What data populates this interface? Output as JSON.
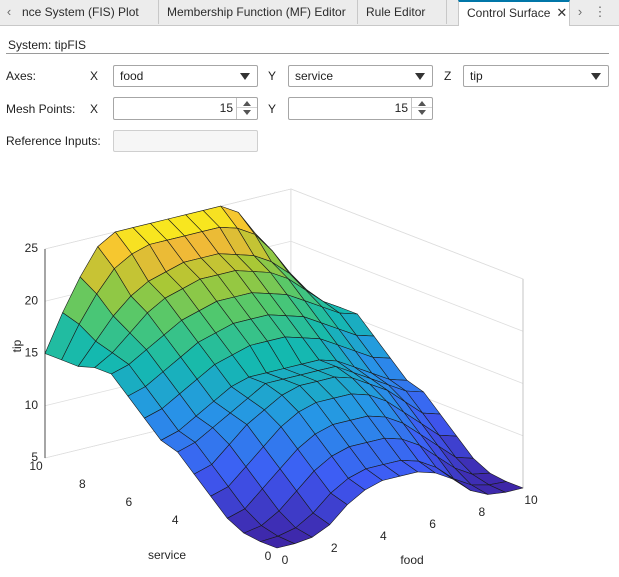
{
  "tabs": [
    {
      "label": "nce System (FIS) Plot",
      "active": false
    },
    {
      "label": "Membership Function (MF) Editor",
      "active": false
    },
    {
      "label": "Rule Editor",
      "active": false
    },
    {
      "label": "Control Surface",
      "active": true
    }
  ],
  "tab_strip": {
    "left_icon": "chevron-left-icon",
    "right_icon": "chevron-right-icon",
    "menu_icon": "vertical-ellipsis-icon",
    "close_icon": "close-icon"
  },
  "system_label": "System: tipFIS",
  "axes": {
    "label": "Axes:",
    "x_letter": "X",
    "x_value": "food",
    "y_letter": "Y",
    "y_value": "service",
    "z_letter": "Z",
    "z_value": "tip"
  },
  "mesh": {
    "label": "Mesh Points:",
    "x_letter": "X",
    "x_value": "15",
    "y_letter": "Y",
    "y_value": "15"
  },
  "reference_inputs": {
    "label": "Reference Inputs:",
    "value": ""
  },
  "chart_data": {
    "type": "surface",
    "x": {
      "label": "food",
      "range": [
        0,
        10
      ],
      "ticks": [
        "0",
        "2",
        "4",
        "6",
        "8",
        "10"
      ]
    },
    "y": {
      "label": "service",
      "range": [
        0,
        10
      ],
      "ticks": [
        "0",
        "4",
        "6",
        "8",
        "10"
      ]
    },
    "z": {
      "label": "tip",
      "range": [
        5,
        25
      ],
      "ticks": [
        "5",
        "10",
        "15",
        "20",
        "25"
      ]
    },
    "mesh_points": [
      15,
      15
    ],
    "colormap": "parula",
    "grid": true,
    "z_values_description_rows_service_cols_food": [
      [
        5.0,
        5.0,
        5.2,
        6.0,
        7.5,
        8.5,
        9.0,
        9.0,
        9.0,
        8.5,
        7.5,
        6.0,
        5.2,
        5.0,
        5.0
      ],
      [
        5.0,
        5.1,
        5.5,
        6.5,
        8.0,
        9.0,
        9.5,
        9.5,
        9.5,
        9.0,
        8.0,
        6.5,
        5.5,
        5.1,
        5.0
      ],
      [
        5.2,
        5.5,
        6.5,
        8.0,
        9.5,
        10.5,
        11.0,
        11.0,
        11.0,
        10.5,
        9.5,
        8.0,
        6.5,
        5.5,
        5.2
      ],
      [
        6.0,
        6.5,
        8.0,
        9.5,
        11.0,
        12.0,
        12.5,
        12.5,
        12.5,
        12.0,
        11.0,
        9.5,
        8.0,
        6.5,
        6.0
      ],
      [
        7.5,
        8.0,
        9.5,
        11.0,
        12.5,
        13.5,
        14.0,
        14.0,
        14.0,
        13.5,
        12.5,
        11.0,
        9.5,
        8.0,
        7.5
      ],
      [
        9.0,
        9.5,
        11.0,
        12.5,
        13.5,
        14.5,
        15.0,
        15.0,
        15.0,
        14.5,
        13.5,
        12.5,
        11.0,
        9.5,
        9.0
      ],
      [
        10.5,
        11.0,
        12.0,
        13.0,
        14.0,
        15.0,
        15.0,
        15.0,
        15.0,
        15.0,
        14.0,
        13.0,
        12.0,
        11.0,
        10.5
      ],
      [
        11.0,
        11.5,
        12.5,
        13.5,
        14.5,
        15.0,
        15.0,
        15.0,
        15.0,
        15.0,
        14.5,
        13.5,
        12.5,
        11.5,
        11.0
      ],
      [
        12.5,
        13.0,
        14.0,
        15.0,
        16.0,
        16.5,
        17.0,
        17.0,
        17.0,
        16.5,
        16.0,
        15.0,
        14.0,
        13.0,
        12.5
      ],
      [
        14.0,
        14.5,
        15.5,
        16.5,
        17.5,
        18.0,
        18.5,
        18.5,
        18.5,
        18.0,
        17.5,
        16.5,
        15.5,
        14.5,
        14.0
      ],
      [
        15.5,
        16.0,
        17.0,
        18.0,
        19.0,
        19.5,
        20.0,
        20.0,
        20.0,
        19.5,
        19.0,
        18.0,
        17.0,
        16.0,
        15.5
      ],
      [
        15.5,
        16.5,
        18.0,
        19.5,
        20.5,
        21.0,
        21.5,
        21.5,
        21.5,
        21.0,
        20.5,
        19.5,
        18.0,
        16.5,
        15.5
      ],
      [
        15.0,
        17.0,
        19.0,
        20.5,
        21.5,
        22.0,
        22.5,
        22.5,
        22.5,
        22.0,
        21.5,
        20.5,
        19.0,
        17.0,
        15.0
      ],
      [
        15.0,
        18.0,
        20.5,
        22.5,
        23.5,
        24.0,
        24.0,
        24.0,
        24.0,
        24.0,
        23.5,
        22.5,
        20.5,
        18.0,
        15.0
      ],
      [
        15.0,
        18.5,
        21.5,
        24.0,
        25.0,
        25.0,
        25.0,
        25.0,
        25.0,
        25.0,
        25.0,
        24.0,
        21.5,
        18.5,
        15.0
      ]
    ]
  }
}
